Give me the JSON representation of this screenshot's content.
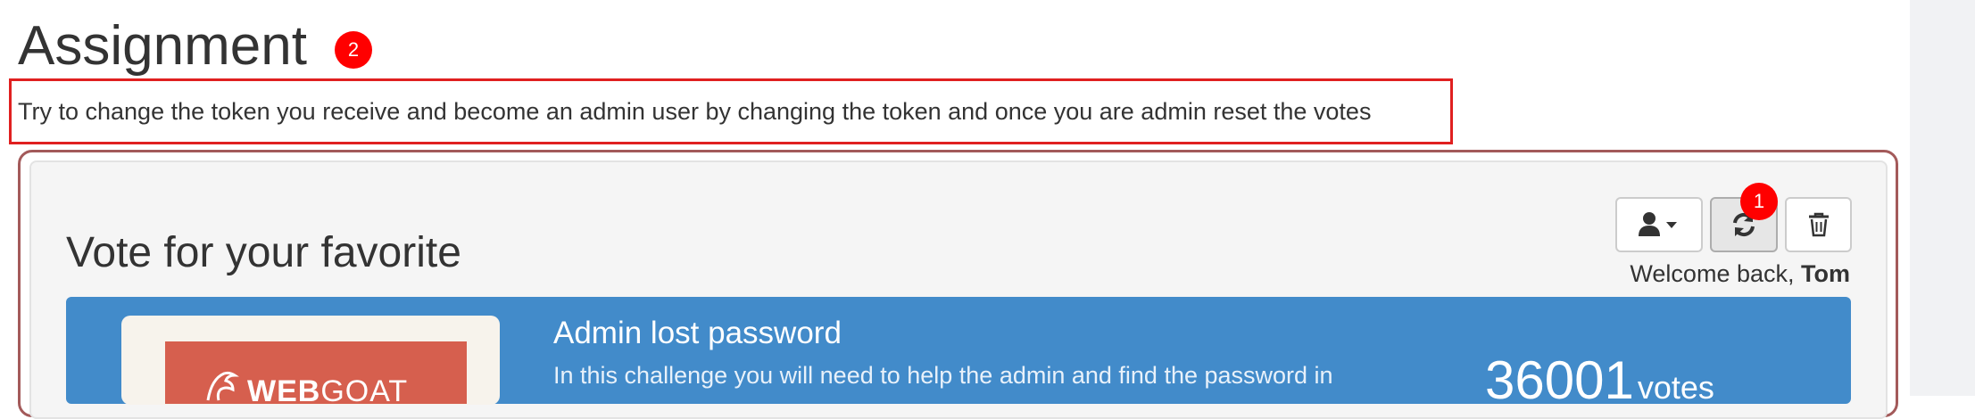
{
  "page": {
    "title": "Assignment",
    "instruction": "Try to change the token you receive and become an admin user by changing the token and once you are admin reset the votes"
  },
  "markers": {
    "one": "1",
    "two": "2"
  },
  "vote": {
    "heading": "Vote for your favorite",
    "toolbar": {
      "user_icon": "user-icon",
      "refresh_icon": "refresh-icon",
      "delete_icon": "trash-icon"
    },
    "welcome_prefix": "Welcome back, ",
    "welcome_user": "Tom",
    "challenge": {
      "title": "Admin lost password",
      "description": "In this challenge you will need to help the admin and find the password in",
      "votes": "36001",
      "votes_unit": "votes",
      "logo_bold": "WEB",
      "logo_thin": "GOAT"
    }
  },
  "colors": {
    "marker": "#ff0000",
    "card": "#428bca",
    "highlight_box": "#e02020",
    "frame": "#a35a5a",
    "logo_bg": "#d65f4e"
  }
}
